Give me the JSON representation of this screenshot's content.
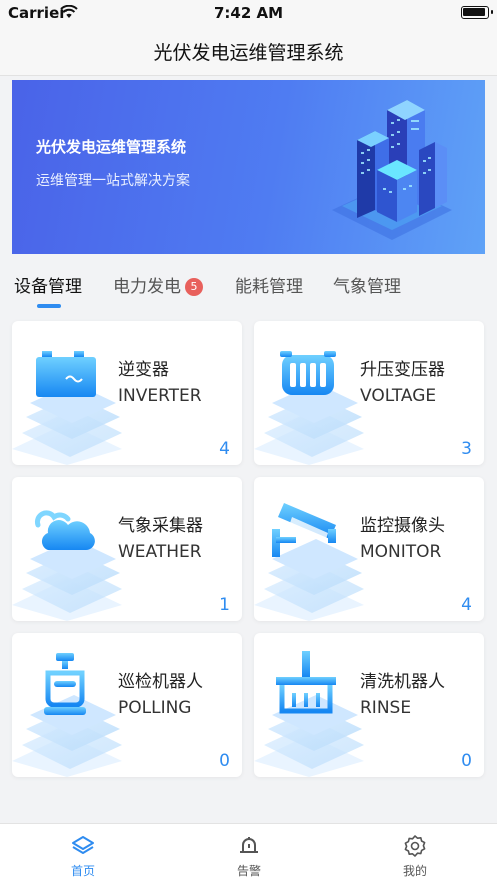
{
  "status_bar": {
    "carrier": "Carrier",
    "time": "7:42 AM"
  },
  "navbar": {
    "title": "光伏发电运维管理系统"
  },
  "banner": {
    "title": "光伏发电运维管理系统",
    "subtitle": "运维管理一站式解决方案"
  },
  "tabs": [
    {
      "label": "设备管理",
      "active": true
    },
    {
      "label": "电力发电",
      "badge": "5"
    },
    {
      "label": "能耗管理"
    },
    {
      "label": "气象管理"
    }
  ],
  "devices": [
    {
      "title": "逆变器",
      "subtitle": "INVERTER",
      "count": "4",
      "icon": "inverter-icon"
    },
    {
      "title": "升压变压器",
      "subtitle": "VOLTAGE",
      "count": "3",
      "icon": "transformer-icon"
    },
    {
      "title": "气象采集器",
      "subtitle": "WEATHER",
      "count": "1",
      "icon": "cloud-icon"
    },
    {
      "title": "监控摄像头",
      "subtitle": "MONITOR",
      "count": "4",
      "icon": "camera-icon"
    },
    {
      "title": "巡检机器人",
      "subtitle": "POLLING",
      "count": "0",
      "icon": "robot-icon"
    },
    {
      "title": "清洗机器人",
      "subtitle": "RINSE",
      "count": "0",
      "icon": "broom-icon"
    }
  ],
  "tabbar": [
    {
      "label": "首页",
      "icon": "home-icon",
      "active": true
    },
    {
      "label": "告警",
      "icon": "bell-icon"
    },
    {
      "label": "我的",
      "icon": "profile-icon"
    }
  ],
  "colors": {
    "accent": "#2f8cf0",
    "badge": "#e8605c",
    "banner_start": "#4a63e8",
    "banner_end": "#5fa2f7"
  }
}
